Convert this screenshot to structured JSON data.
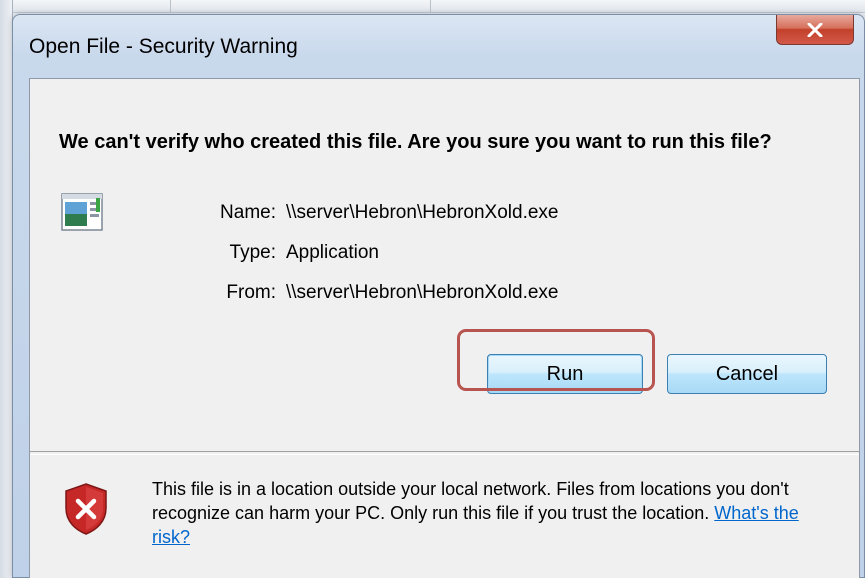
{
  "window": {
    "title": "Open File - Security Warning",
    "close_icon": "close-icon"
  },
  "dialog": {
    "headline": "We can't verify who created this file. Are you sure you want to run this file?",
    "file_icon": "application-icon",
    "fields": {
      "name_label": "Name:",
      "name_value": "\\\\server\\Hebron\\HebronXold.exe",
      "type_label": "Type:",
      "type_value": "Application",
      "from_label": "From:",
      "from_value": "\\\\server\\Hebron\\HebronXold.exe"
    },
    "buttons": {
      "run_label": "Run",
      "cancel_label": "Cancel"
    },
    "warning": {
      "icon": "shield-warning-icon",
      "text": "This file is in a location outside your local network. Files from locations you don't recognize can harm your PC. Only run this file if you trust the location. ",
      "link_label": "What's the risk?"
    }
  },
  "colors": {
    "highlight": "#b85450",
    "link": "#0066cc",
    "close_button": "#c2412a",
    "shield": "#c62828"
  }
}
